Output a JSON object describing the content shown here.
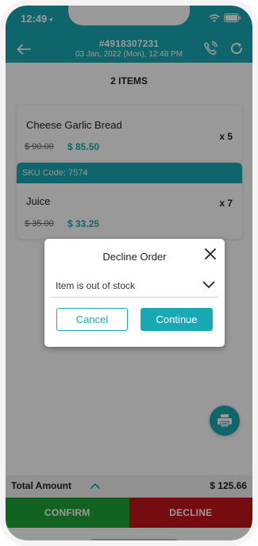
{
  "status_bar": {
    "time": "12:49"
  },
  "header": {
    "order_number": "#4918307231",
    "order_datetime": "03 Jan, 2022 (Mon),  12:48 PM",
    "icons": [
      "back-arrow-icon",
      "phone-call-icon",
      "refresh-icon"
    ],
    "accent_color": "#19a9b5"
  },
  "summary": {
    "items_title": "2 ITEMS"
  },
  "items": [
    {
      "name": "Cheese Garlic Bread",
      "old_price": "$ 90.00",
      "new_price": "$ 85.50",
      "quantity": "x 5"
    },
    {
      "sku": "SKU Code: 7574",
      "name": "Juice",
      "old_price": "$ 35.00",
      "new_price": "$ 33.25",
      "quantity": "x 7"
    }
  ],
  "total": {
    "label": "Total Amount",
    "amount": "$ 125.66"
  },
  "actions": {
    "confirm_label": "CONFIRM",
    "decline_label": "DECLINE",
    "confirm_color": "#1fa337",
    "decline_color": "#c4151a"
  },
  "modal": {
    "title": "Decline Order",
    "reason_selected": "Item is out of stock",
    "cancel_label": "Cancel",
    "continue_label": "Continue"
  }
}
